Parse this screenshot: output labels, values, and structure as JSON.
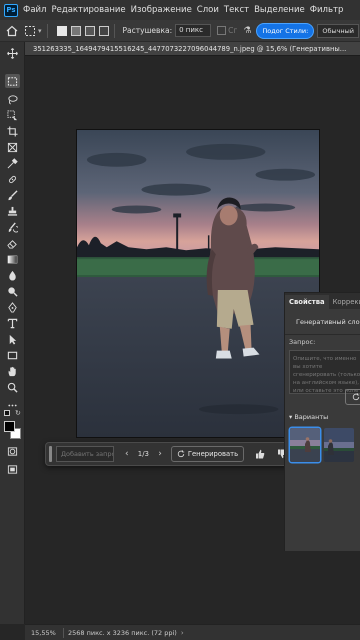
{
  "app": {
    "logo_text": "Ps"
  },
  "menu": {
    "items": [
      "Файл",
      "Редактирование",
      "Изображение",
      "Слои",
      "Текст",
      "Выделение",
      "Фильтр"
    ]
  },
  "options": {
    "feather_label": "Растушевка:",
    "feather_value": "0 пикс",
    "antialias_dim": "Сг",
    "select_subject_label": "Подог Стили:",
    "style_value": "Обычный"
  },
  "document": {
    "tab_title": "351263335_1649479415516245_4477073227096044789_n.jpeg @ 15,6% (Генеративны..."
  },
  "taskbar": {
    "prompt_placeholder": "Добавить запрос...",
    "counter": "1/3",
    "generate_label": "Генерировать"
  },
  "panel": {
    "tabs": [
      "Свойства",
      "Коррекция"
    ],
    "title": "Генеративный слой",
    "prompt_label": "Запрос:",
    "prompt_placeholder": "Опишите, что именно вы хотите сгенерировать (только на английском языке), или оставьте это поле пустым.",
    "variants_label": "Варианты"
  },
  "status": {
    "zoom": "15,55%",
    "doc_info": "2568 пикс. x 3236 пикс. (72 ppi)"
  },
  "colors": {
    "accent": "#1473e6",
    "ui_bg": "#262626",
    "panel_bg": "#3a3a3a"
  }
}
